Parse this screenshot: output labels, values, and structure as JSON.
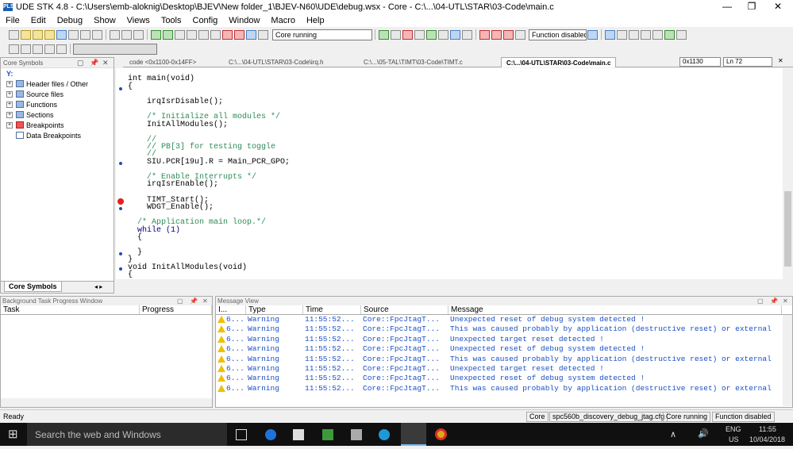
{
  "window": {
    "title": "UDE STK 4.8 - C:\\Users\\emb-aloknig\\Desktop\\BJEV\\New folder_1\\BJEV-N60\\UDE\\debug.wsx - Core - C:\\...\\04-UTL\\STAR\\03-Code\\main.c",
    "app_badge": "PLS",
    "minimize": "—",
    "maximize": "❐",
    "close": "✕"
  },
  "menu": [
    "File",
    "Edit",
    "Debug",
    "Show",
    "Views",
    "Tools",
    "Config",
    "Window",
    "Macro",
    "Help"
  ],
  "toolbar": {
    "core_status": "Core running",
    "function_status": "Function disabled"
  },
  "left_pane": {
    "title": "Core Symbols",
    "pin": "📌",
    "close": "✕",
    "filter_glyph": "Y:",
    "items": [
      "Header files / Other",
      "Source files",
      "Functions",
      "Sections",
      "Breakpoints",
      "Data Breakpoints"
    ],
    "tab_label": "Core Symbols"
  },
  "editor": {
    "address": "0x1130",
    "line": "Ln 72",
    "tabs": [
      "code <0x1100-0x14FF>",
      "C:\\...\\04-UTL\\STAR\\03-Code\\irq.h",
      "C:\\...\\05-TAL\\TIMT\\03-Code\\TIMT.c",
      "C:\\...\\04-UTL\\STAR\\03-Code\\main.c"
    ],
    "lines": [
      {
        "t": "int main(void)",
        "c": "kw"
      },
      {
        "t": "{",
        "c": ""
      },
      {
        "t": "    irqIsrDisable();",
        "c": ""
      },
      {
        "t": "    /* Initialize all modules */",
        "c": "cmt"
      },
      {
        "t": "    InitAllModules();",
        "c": ""
      },
      {
        "t": "    //",
        "c": "cmt"
      },
      {
        "t": "    // PB[3] for testing toggle",
        "c": "cmt"
      },
      {
        "t": "    //",
        "c": "cmt"
      },
      {
        "t": "    SIU.PCR[19u].R = Main_PCR_GPO;",
        "c": ""
      },
      {
        "t": "    /* Enable Interrupts */",
        "c": "cmt"
      },
      {
        "t": "    irqIsrEnable();",
        "c": ""
      },
      {
        "t": "    TIMT_Start();",
        "c": ""
      },
      {
        "t": "    WDGT_Enable();",
        "c": ""
      },
      {
        "t": "  /* Application main loop.*/",
        "c": "cmt"
      },
      {
        "t": "  while (1)",
        "c": "kw"
      },
      {
        "t": "  {",
        "c": ""
      },
      {
        "t": "  }",
        "c": ""
      },
      {
        "t": "}",
        "c": ""
      },
      {
        "t": "void InitAllModules(void)",
        "c": "kw"
      },
      {
        "t": "{",
        "c": ""
      }
    ]
  },
  "bg_panel": {
    "title": "Background Task Progress Window",
    "col_task": "Task",
    "col_progress": "Progress"
  },
  "msg_panel": {
    "title": "Message View",
    "cols": [
      "I...",
      "Type",
      "Time",
      "Source",
      "Message"
    ],
    "rows": [
      {
        "i": "6...",
        "type": "Warning",
        "time": "11:55:52...",
        "source": "Core::FpcJtagT...",
        "message": "Unexpected reset of debug system detected !"
      },
      {
        "i": "6...",
        "type": "Warning",
        "time": "11:55:52...",
        "source": "Core::FpcJtagT...",
        "message": "This was caused probably by application (destructive reset) or external"
      },
      {
        "i": "6...",
        "type": "Warning",
        "time": "11:55:52...",
        "source": "Core::FpcJtagT...",
        "message": "Unexpected target reset detected !"
      },
      {
        "i": "6...",
        "type": "Warning",
        "time": "11:55:52...",
        "source": "Core::FpcJtagT...",
        "message": "Unexpected reset of debug system detected !"
      },
      {
        "i": "6...",
        "type": "Warning",
        "time": "11:55:52...",
        "source": "Core::FpcJtagT...",
        "message": "This was caused probably by application (destructive reset) or external"
      },
      {
        "i": "6...",
        "type": "Warning",
        "time": "11:55:52...",
        "source": "Core::FpcJtagT...",
        "message": "Unexpected target reset detected !"
      },
      {
        "i": "6...",
        "type": "Warning",
        "time": "11:55:52...",
        "source": "Core::FpcJtagT...",
        "message": "Unexpected reset of debug system detected !"
      },
      {
        "i": "6...",
        "type": "Warning",
        "time": "11:55:52...",
        "source": "Core::FpcJtagT...",
        "message": "This was caused probably by application (destructive reset) or external"
      }
    ]
  },
  "status": {
    "ready": "Ready",
    "core": "Core",
    "config": "spc560b_discovery_debug_jtag.cfg",
    "core_running": "Core running",
    "function_disabled": "Function disabled"
  },
  "taskbar": {
    "search": "Search the web and Windows",
    "lang1": "ENG",
    "lang2": "US",
    "time": "11:55",
    "date": "10/04/2018",
    "start_glyph": "⊞",
    "up_glyph": "∧",
    "speaker_glyph": "🔊"
  }
}
